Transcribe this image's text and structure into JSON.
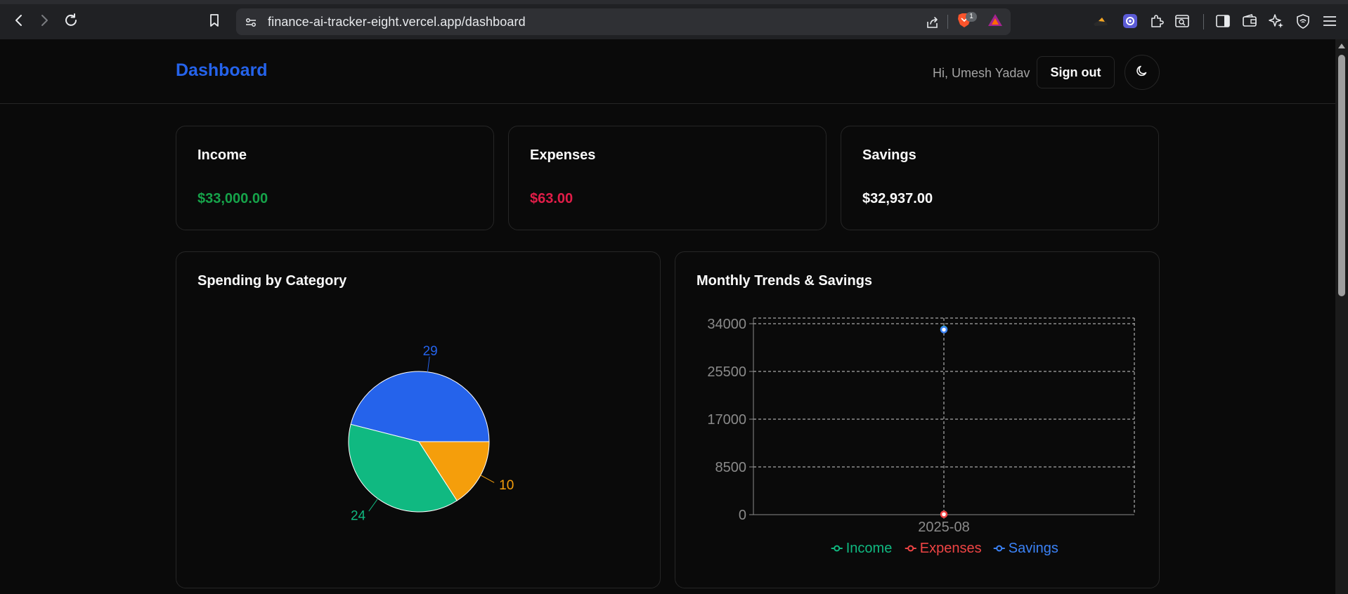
{
  "browser": {
    "url": "finance-ai-tracker-eight.vercel.app/dashboard",
    "brave_badge_count": "1"
  },
  "header": {
    "brand": "Dashboard",
    "greeting": "Hi, Umesh Yadav",
    "sign_out_label": "Sign out"
  },
  "stats": {
    "income": {
      "title": "Income",
      "value": "$33,000.00",
      "color": "#16a34a"
    },
    "expenses": {
      "title": "Expenses",
      "value": "$63.00",
      "color": "#e11d48"
    },
    "savings": {
      "title": "Savings",
      "value": "$32,937.00",
      "color": "#fafafa"
    }
  },
  "charts": {
    "pie_title": "Spending by Category",
    "line_title": "Monthly Trends & Savings"
  },
  "chart_data": [
    {
      "type": "pie",
      "values": [
        29,
        24,
        10
      ],
      "colors": [
        "#2563eb",
        "#10b981",
        "#f59e0b"
      ],
      "labels": [
        "29",
        "24",
        "10"
      ]
    },
    {
      "type": "line",
      "categories": [
        "2025-08"
      ],
      "ylim": [
        0,
        34000
      ],
      "yticks": [
        0,
        8500,
        17000,
        25500,
        34000
      ],
      "grid": true,
      "legend_position": "bottom",
      "series": [
        {
          "name": "Income",
          "values": [
            33000
          ],
          "color": "#10b981"
        },
        {
          "name": "Expenses",
          "values": [
            63
          ],
          "color": "#ef4444"
        },
        {
          "name": "Savings",
          "values": [
            32937
          ],
          "color": "#3b82f6"
        }
      ]
    }
  ]
}
